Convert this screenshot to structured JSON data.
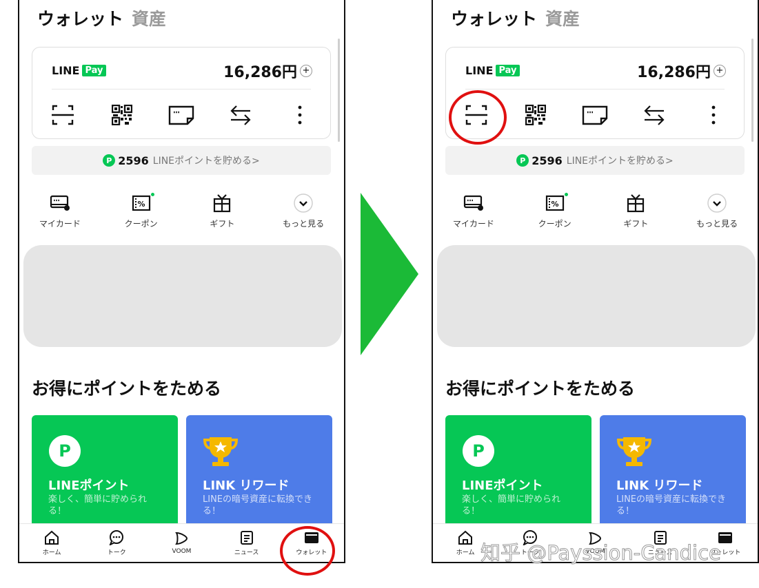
{
  "wallet": {
    "title": "ウォレット",
    "subtitle": "資産",
    "pay_brand": "LINE",
    "pay_badge": "Pay",
    "balance": "16,286円",
    "balance_plus": "+",
    "points_icon": "P",
    "points_value": "2596",
    "points_text": "LINEポイントを貯める>",
    "quick_items": [
      {
        "label": "マイカード",
        "icon": "card-icon"
      },
      {
        "label": "クーポン",
        "icon": "coupon-icon"
      },
      {
        "label": "ギフト",
        "icon": "gift-icon"
      },
      {
        "label": "もっと見る",
        "icon": "chevron-down-icon"
      }
    ],
    "section_title": "お得にポイントをためる",
    "tiles": [
      {
        "title": "LINEポイント",
        "desc": "楽しく、簡単に貯められる！",
        "icon_text": "P",
        "color": "#06c755"
      },
      {
        "title": "LINK リワード",
        "desc": "LINEの暗号資産に転換できる！",
        "color": "#4e7ce8"
      }
    ],
    "tabs": [
      {
        "label": "ホーム",
        "icon": "home-icon"
      },
      {
        "label": "トーク",
        "icon": "chat-icon"
      },
      {
        "label": "VOOM",
        "icon": "voom-icon"
      },
      {
        "label": "ニュース",
        "icon": "news-icon"
      },
      {
        "label": "ウォレット",
        "icon": "wallet-icon"
      }
    ]
  },
  "watermark": "知乎 @Payssion-Candice",
  "colors": {
    "line_green": "#06c755",
    "tile_blue": "#4e7ce8",
    "arrow_green": "#1bba37",
    "highlight_red": "#e01010"
  }
}
